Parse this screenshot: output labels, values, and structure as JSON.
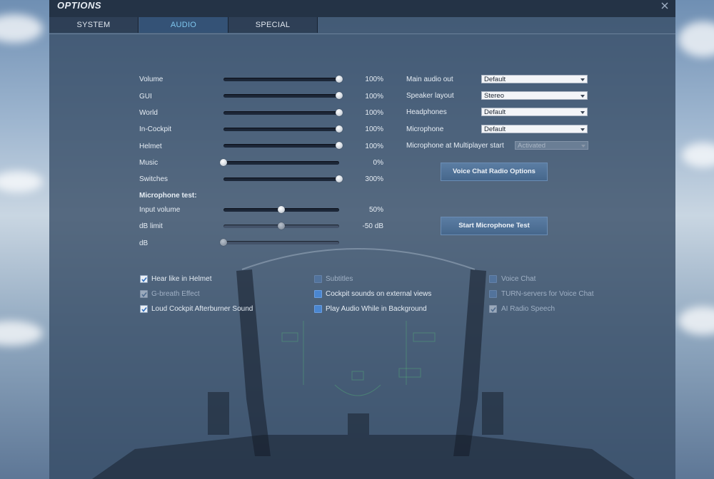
{
  "window": {
    "title": "OPTIONS"
  },
  "tabs": [
    {
      "label": "SYSTEM",
      "active": false
    },
    {
      "label": "AUDIO",
      "active": true
    },
    {
      "label": "SPECIAL",
      "active": false
    }
  ],
  "sliders": [
    {
      "label": "Volume",
      "value": "100%",
      "level": 1.0
    },
    {
      "label": "GUI",
      "value": "100%",
      "level": 1.0
    },
    {
      "label": "World",
      "value": "100%",
      "level": 1.0
    },
    {
      "label": "In-Cockpit",
      "value": "100%",
      "level": 1.0
    },
    {
      "label": "Helmet",
      "value": "100%",
      "level": 1.0
    },
    {
      "label": "Music",
      "value": "0%",
      "level": 0.0
    },
    {
      "label": "Switches",
      "value": "300%",
      "level": 1.0
    }
  ],
  "mic_test": {
    "heading": "Microphone test:",
    "input_volume": {
      "label": "Input volume",
      "value": "50%",
      "level": 0.5
    },
    "db_limit": {
      "label": "dB limit",
      "value": "-50 dB",
      "level": 0.5
    },
    "db": {
      "label": "dB",
      "level": 0.0
    }
  },
  "devices": [
    {
      "label": "Main audio out",
      "value": "Default",
      "disabled": false
    },
    {
      "label": "Speaker layout",
      "value": "Stereo",
      "disabled": false
    },
    {
      "label": "Headphones",
      "value": "Default",
      "disabled": false
    },
    {
      "label": "Microphone",
      "value": "Default",
      "disabled": false
    }
  ],
  "mp_start": {
    "label": "Microphone at Multiplayer start",
    "value": "Activated",
    "disabled": true
  },
  "buttons": {
    "voice_chat_radio": "Voice Chat Radio Options",
    "start_mic_test": "Start Microphone Test"
  },
  "checkboxes": [
    {
      "label": "Hear like in Helmet",
      "checked": true,
      "dim": false
    },
    {
      "label": "G-breath Effect",
      "checked": true,
      "dim": true
    },
    {
      "label": "Loud Cockpit Afterburner Sound",
      "checked": true,
      "dim": false
    },
    {
      "label": "Subtitles",
      "checked": false,
      "dim": true
    },
    {
      "label": "Cockpit sounds on external views",
      "checked": false,
      "dim": false
    },
    {
      "label": "Play Audio While in Background",
      "checked": false,
      "dim": false
    },
    {
      "label": "Voice Chat",
      "checked": false,
      "dim": true
    },
    {
      "label": "TURN-servers for Voice Chat",
      "checked": false,
      "dim": true
    },
    {
      "label": "AI Radio Speech",
      "checked": true,
      "dim": true
    }
  ],
  "colors": {
    "accent": "#7fc6ee",
    "checkbox_off": "#4a86d0",
    "panel": "#344a64"
  }
}
